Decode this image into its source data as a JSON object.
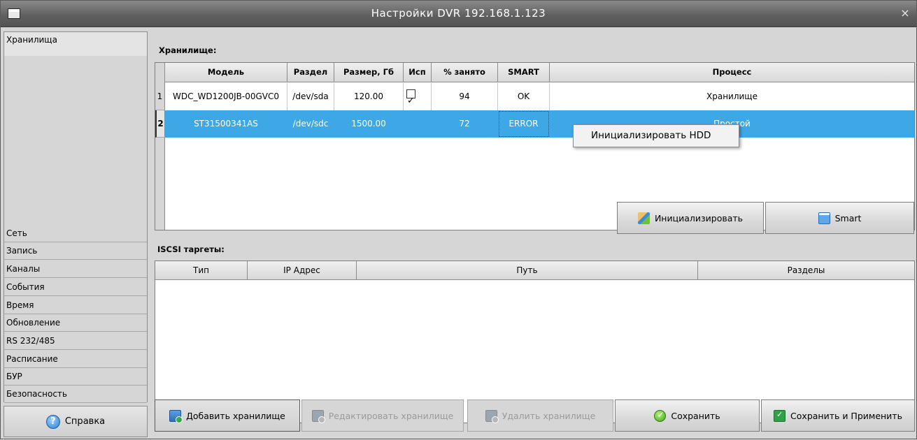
{
  "window": {
    "title": "Настройки DVR 192.168.1.123",
    "close_glyph": "×"
  },
  "sidebar": {
    "items": [
      {
        "label": "Хранилища",
        "active": true
      },
      {
        "label": "Сеть"
      },
      {
        "label": "Запись"
      },
      {
        "label": "Каналы"
      },
      {
        "label": "События"
      },
      {
        "label": "Время"
      },
      {
        "label": "Обновление"
      },
      {
        "label": "RS 232/485"
      },
      {
        "label": "Расписание"
      },
      {
        "label": "БУР"
      },
      {
        "label": "Безопасность"
      }
    ],
    "help_label": "Справка"
  },
  "storage": {
    "section_label": "Хранилище:",
    "columns": [
      "Модель",
      "Раздел",
      "Размер, Гб",
      "Исп",
      "% занято",
      "SMART",
      "Процесс"
    ],
    "rows": [
      {
        "num": "1",
        "model": "WDC_WD1200JB-00GVC0",
        "partition": "/dev/sda",
        "size": "120.00",
        "used": true,
        "percent": "94",
        "smart": "OK",
        "process": "Хранилище"
      },
      {
        "num": "2",
        "model": "ST31500341AS",
        "partition": "/dev/sdc",
        "size": "1500.00",
        "used": false,
        "percent": "72",
        "smart": "ERROR",
        "process": "Простой",
        "selected": true
      }
    ],
    "context_menu": {
      "item": "Инициализировать HDD"
    },
    "buttons": {
      "init": "Инициализировать",
      "smart": "Smart"
    }
  },
  "iscsi": {
    "section_label": "ISCSI таргеты:",
    "columns": [
      "Тип",
      "IP Адрес",
      "Путь",
      "Разделы"
    ]
  },
  "actions": {
    "add": "Добавить хранилище",
    "edit": "Редактировать хранилище",
    "delete": "Удалить хранилище",
    "save": "Сохранить",
    "save_apply": "Сохранить и Применить"
  },
  "colors": {
    "selection": "#3ea8e6",
    "titlebar": "#5e5e5e"
  }
}
